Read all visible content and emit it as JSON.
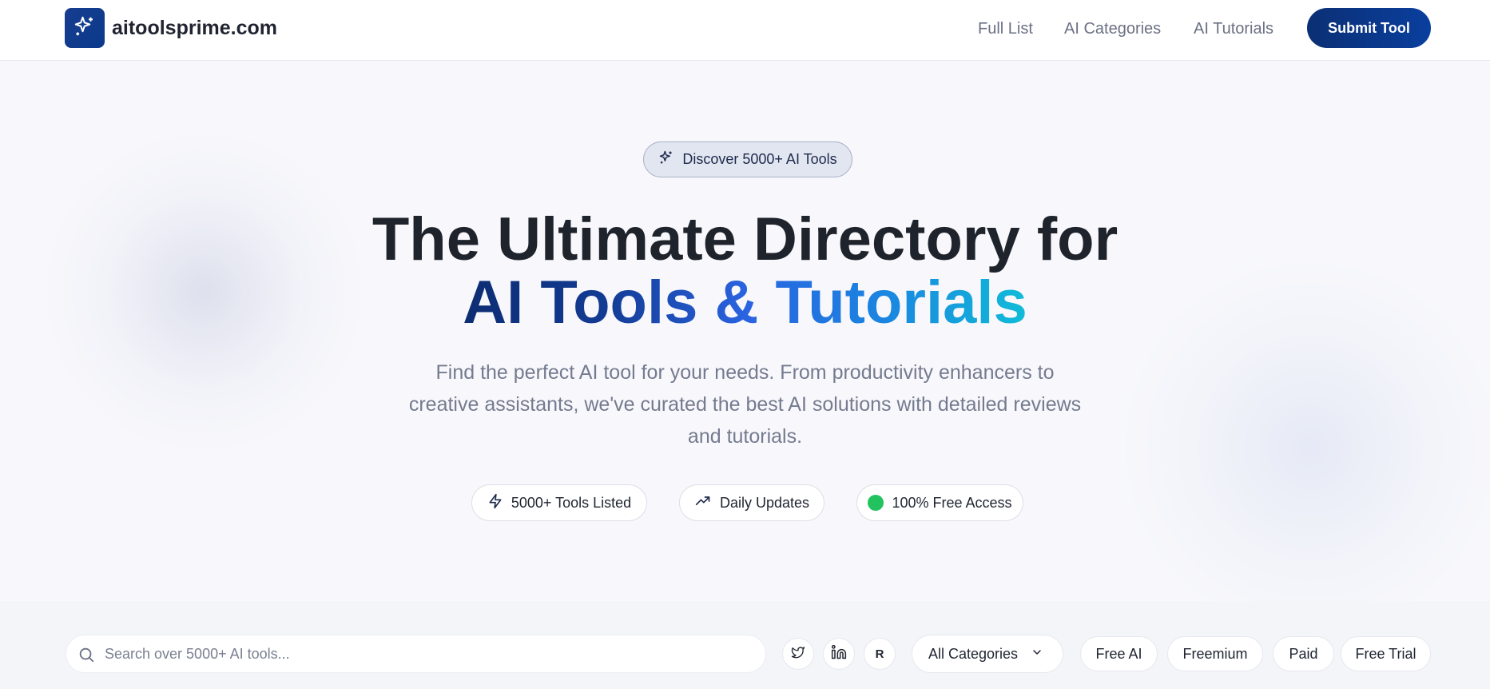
{
  "header": {
    "site_name": "aitoolsprime.com",
    "nav": [
      "Full List",
      "AI Categories",
      "AI Tutorials"
    ],
    "submit_label": "Submit Tool"
  },
  "hero": {
    "badge": "Discover 5000+ AI Tools",
    "title_line1": "The Ultimate Directory for",
    "title_line2": "AI Tools & Tutorials",
    "subtitle": "Find the perfect AI tool for your needs. From productivity enhancers to creative assistants, we've curated the best AI solutions with detailed reviews and tutorials.",
    "stats": [
      {
        "icon": "lightning-icon",
        "label": "5000+ Tools Listed"
      },
      {
        "icon": "trending-up-icon",
        "label": "Daily Updates"
      },
      {
        "icon": "green-dot-icon",
        "label": "100% Free Access"
      }
    ]
  },
  "toolbar": {
    "search_placeholder": "Search over 5000+ AI tools...",
    "search_value": "",
    "socials": [
      {
        "icon": "twitter-icon"
      },
      {
        "icon": "linkedin-icon"
      },
      {
        "icon": "reddit-icon",
        "label": "R"
      }
    ],
    "category_select": "All Categories",
    "filters": [
      "Free AI",
      "Freemium",
      "Paid",
      "Free Trial"
    ]
  },
  "colors": {
    "brand_dark": "#0b2f74",
    "accent_gradient_end": "#10bcd8",
    "status_green": "#22c35e"
  }
}
